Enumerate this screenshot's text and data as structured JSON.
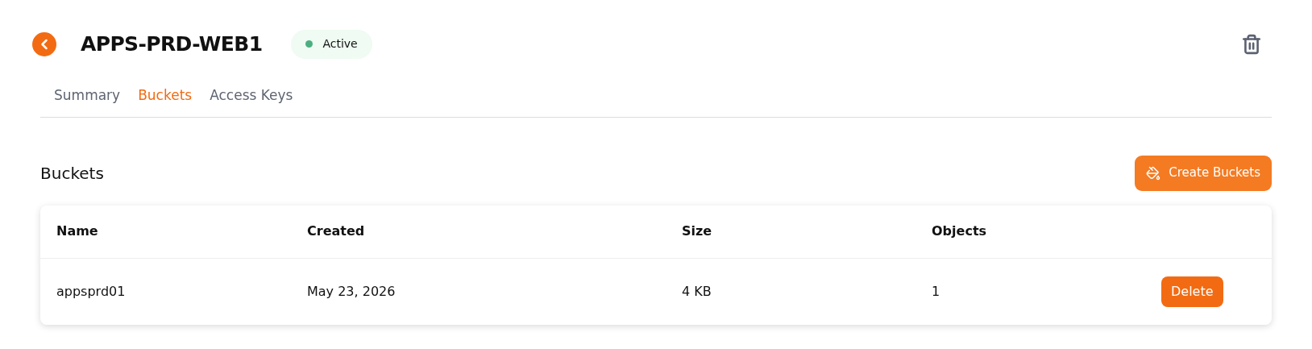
{
  "header": {
    "title": "APPS-PRD-WEB1",
    "status": "Active"
  },
  "tabs": [
    {
      "label": "Summary",
      "selected": false
    },
    {
      "label": "Buckets",
      "selected": true
    },
    {
      "label": "Access Keys",
      "selected": false
    }
  ],
  "section": {
    "title": "Buckets",
    "create_button": "Create Buckets"
  },
  "table": {
    "columns": [
      "Name",
      "Created",
      "Size",
      "Objects"
    ],
    "rows": [
      {
        "cells": [
          "appsprd01",
          "May 23, 2026",
          "4 KB",
          "1"
        ],
        "action": "Delete"
      }
    ]
  }
}
